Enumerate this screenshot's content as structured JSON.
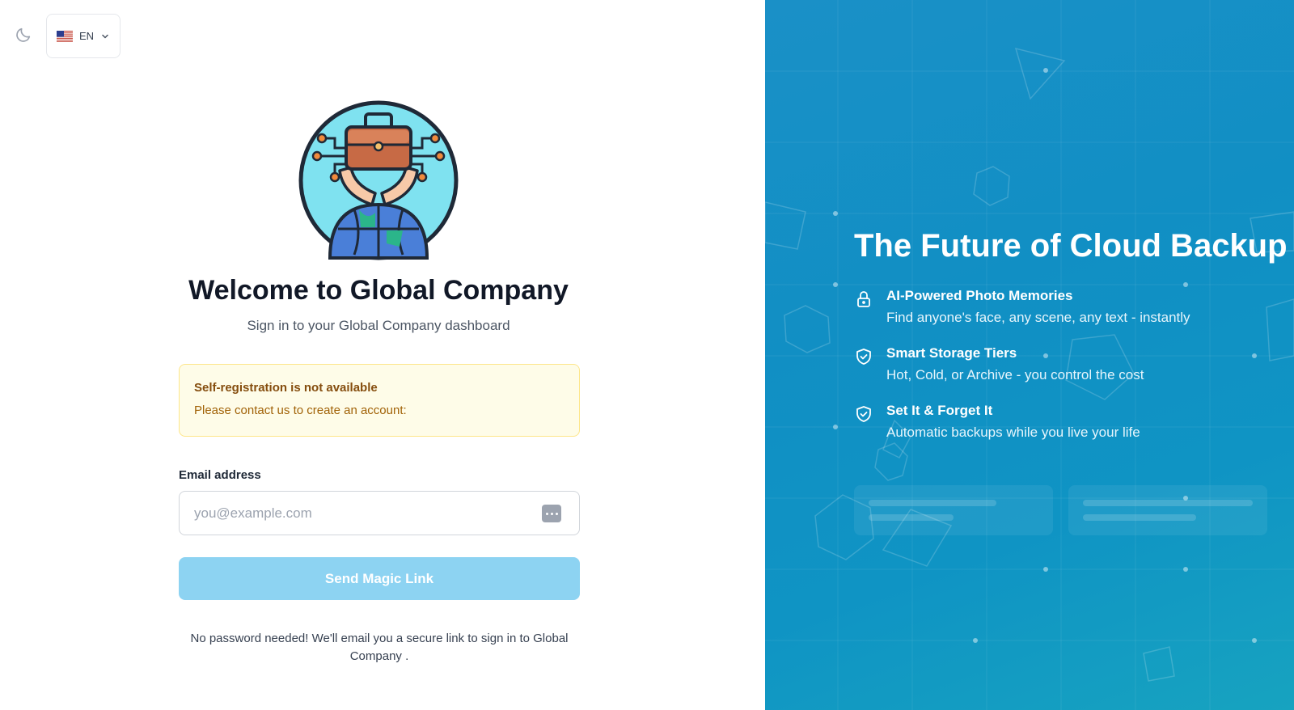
{
  "header": {
    "theme_icon": "moon-icon",
    "language": {
      "code": "EN",
      "flag": "us-flag-icon",
      "chevron": "chevron-down-icon"
    }
  },
  "logo": {
    "icon": "briefcase-globe-logo"
  },
  "welcome": {
    "title": "Welcome to Global Company",
    "subtitle": "Sign in to your Global Company dashboard"
  },
  "notice": {
    "title": "Self-registration is not available",
    "body": "Please contact us to create an account:"
  },
  "form": {
    "email_label": "Email address",
    "email_placeholder": "you@example.com",
    "email_value": "",
    "submit_label": "Send Magic Link",
    "footnote": "No password needed! We'll email you a secure link to sign in to Global Company ."
  },
  "hero": {
    "title": "The Future of Cloud Backup",
    "features": [
      {
        "icon": "lock-icon",
        "title": "AI-Powered Photo Memories",
        "desc": "Find anyone's face, any scene, any text - instantly"
      },
      {
        "icon": "shield-check-icon",
        "title": "Smart Storage Tiers",
        "desc": "Hot, Cold, or Archive - you control the cost"
      },
      {
        "icon": "shield-check-icon",
        "title": "Set It & Forget It",
        "desc": "Automatic backups while you live your life"
      }
    ]
  },
  "colors": {
    "accent_button": "#8dd3f2",
    "hero_background": "#1190c5",
    "notice_background": "#fefce8",
    "notice_title": "#854d0e",
    "notice_body": "#a16207",
    "title_text": "#111827"
  }
}
